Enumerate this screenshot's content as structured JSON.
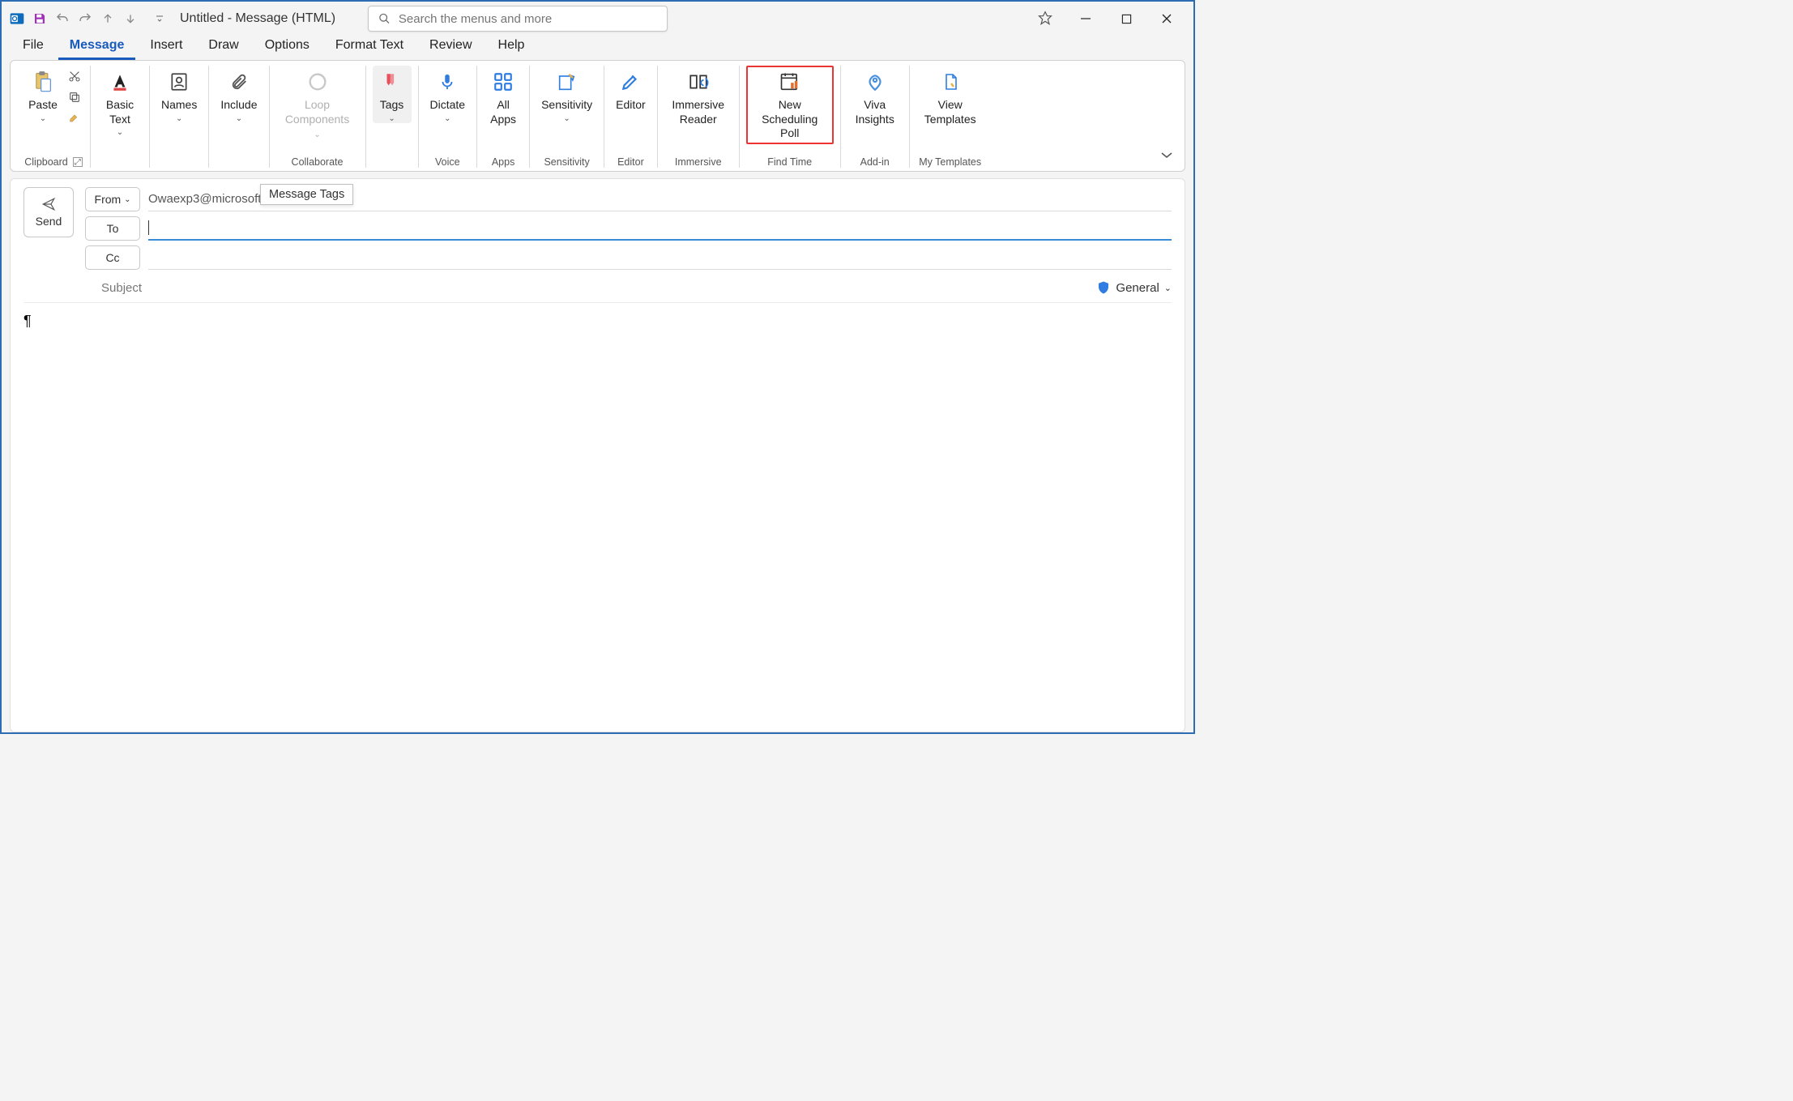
{
  "title": "Untitled  -  Message (HTML)",
  "search_placeholder": "Search the menus and more",
  "tabs": {
    "file": "File",
    "message": "Message",
    "insert": "Insert",
    "draw": "Draw",
    "options": "Options",
    "format_text": "Format Text",
    "review": "Review",
    "help": "Help"
  },
  "ribbon": {
    "clipboard": {
      "paste": "Paste",
      "group": "Clipboard"
    },
    "basictext": {
      "label": "Basic Text"
    },
    "names": {
      "label": "Names"
    },
    "include": {
      "label": "Include"
    },
    "loop": {
      "label": "Loop Components",
      "group": "Collaborate"
    },
    "tags": {
      "label": "Tags"
    },
    "dictate": {
      "label": "Dictate",
      "group": "Voice"
    },
    "apps": {
      "label": "All Apps",
      "group": "Apps"
    },
    "sensitivity": {
      "label": "Sensitivity",
      "group": "Sensitivity"
    },
    "editor": {
      "label": "Editor",
      "group": "Editor"
    },
    "reader": {
      "label": "Immersive Reader",
      "group": "Immersive"
    },
    "poll": {
      "label": "New Scheduling Poll",
      "group": "Find Time"
    },
    "viva": {
      "label": "Viva Insights",
      "group": "Add-in"
    },
    "templates": {
      "label": "View Templates",
      "group": "My Templates"
    }
  },
  "tooltip": "Message Tags",
  "compose": {
    "send": "Send",
    "from_btn": "From",
    "from_value": "Owaexp3@microsoft.com",
    "to_btn": "To",
    "cc_btn": "Cc",
    "subject_label": "Subject",
    "sensitivity_label": "General",
    "body_marker": "¶"
  }
}
